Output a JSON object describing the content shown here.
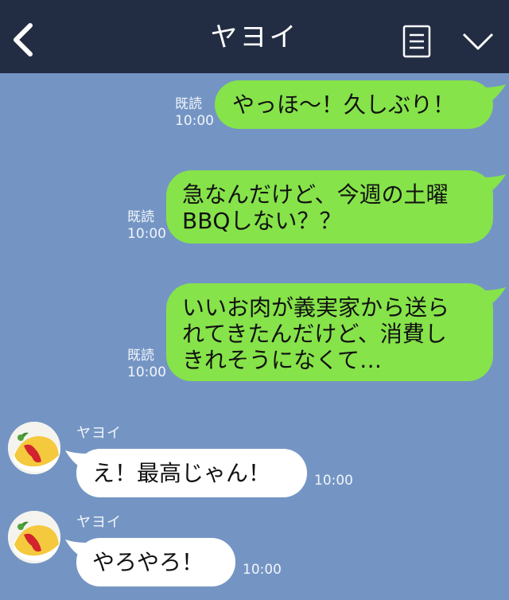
{
  "header": {
    "title": "ヤヨイ",
    "back_icon": "chevron-left-icon",
    "notes_icon": "notes-icon",
    "menu_icon": "chevron-down-icon",
    "background": "#222c43"
  },
  "chat": {
    "background": "#7495c4",
    "outgoing_color": "#86e34a",
    "incoming_color": "#ffffff",
    "outgoing": [
      {
        "text": "やっほ〜！久しぶり！",
        "read": "既読",
        "time": "10:00"
      },
      {
        "text": "急なんだけど、今週の土曜\nBBQしない？？",
        "read": "既読",
        "time": "10:00"
      },
      {
        "text": "いいお肉が義実家から送ら\nれてきたんだけど、消費し\nきれそうになくて…",
        "read": "既読",
        "time": "10:00"
      }
    ],
    "incoming": [
      {
        "sender": "ヤヨイ",
        "text": "え！最高じゃん！",
        "time": "10:00"
      },
      {
        "sender": "ヤヨイ",
        "text": "やろやろ！",
        "time": "10:00"
      }
    ]
  }
}
